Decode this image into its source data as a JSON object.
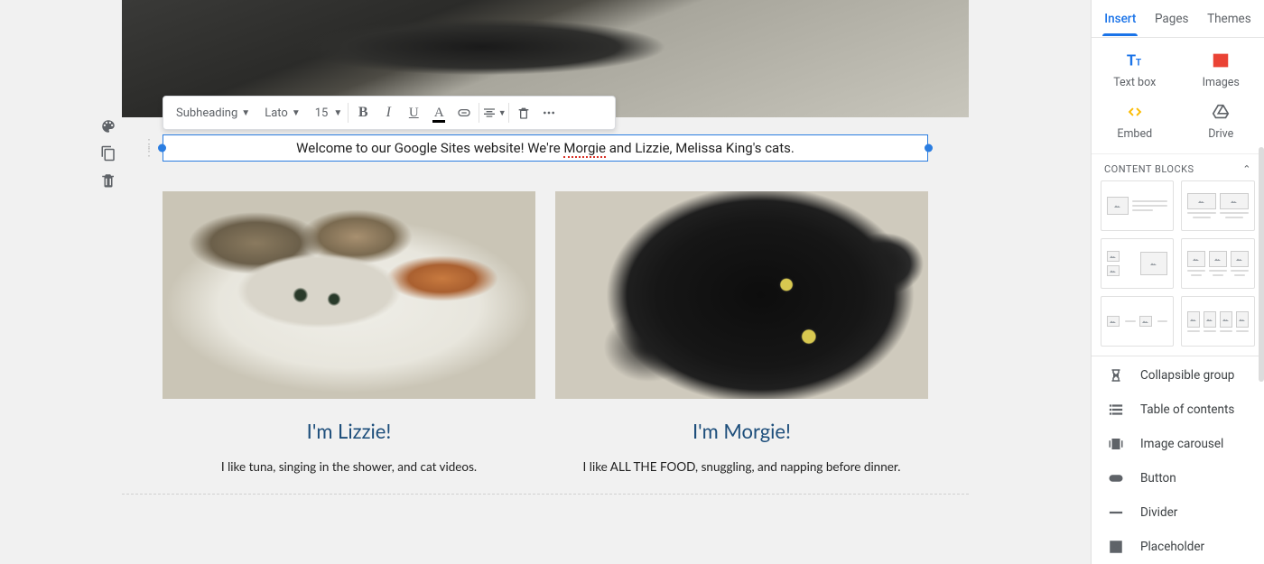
{
  "sidebar": {
    "tabs": {
      "insert": "Insert",
      "pages": "Pages",
      "themes": "Themes"
    },
    "insert_items": {
      "textbox": "Text box",
      "images": "Images",
      "embed": "Embed",
      "drive": "Drive"
    },
    "content_blocks_label": "CONTENT BLOCKS",
    "list": {
      "collapsible": "Collapsible group",
      "toc": "Table of contents",
      "carousel": "Image carousel",
      "button": "Button",
      "divider": "Divider",
      "placeholder": "Placeholder"
    }
  },
  "toolbar": {
    "style_select": "Subheading",
    "font_select": "Lato",
    "font_size": "15"
  },
  "content": {
    "welcome_pre": "Welcome to our Google Sites website! We're ",
    "welcome_spell": "Morgie",
    "welcome_post": " and Lizzie, Melissa King's cats.",
    "lizzie": {
      "title": "I'm Lizzie!",
      "desc": "I like tuna, singing in the shower, and cat videos."
    },
    "morgie": {
      "title": "I'm Morgie!",
      "desc": "I like ALL THE FOOD, snuggling, and napping before dinner."
    }
  }
}
